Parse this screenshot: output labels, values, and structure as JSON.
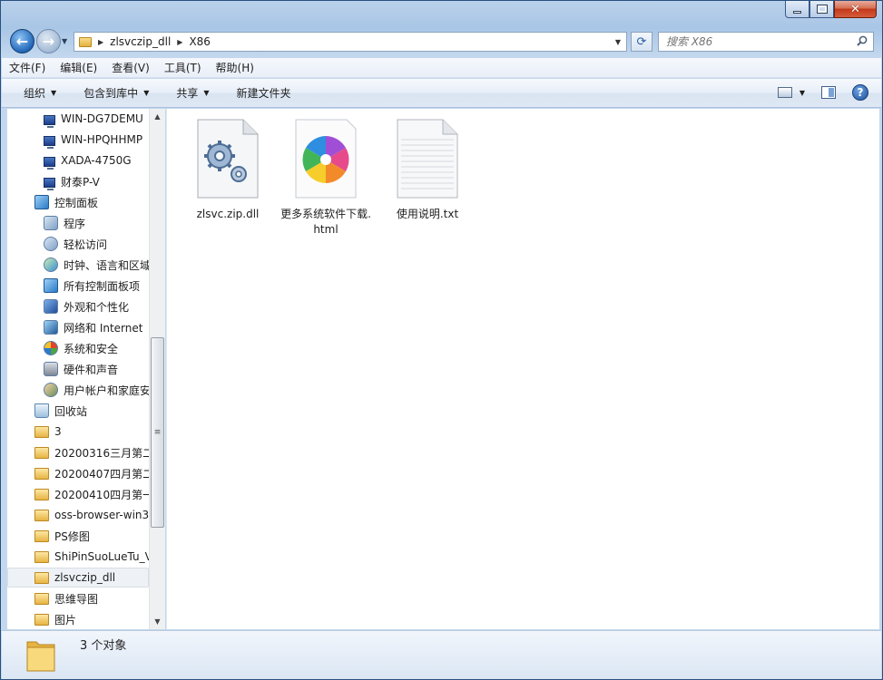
{
  "window": {
    "controls": {
      "minimize": "minimize",
      "maximize": "maximize",
      "close": "✕"
    }
  },
  "address": {
    "crumbs": [
      "zlsvczip_dll",
      "X86"
    ],
    "search_placeholder": "搜索 X86"
  },
  "menubar": {
    "items": [
      "文件(F)",
      "编辑(E)",
      "查看(V)",
      "工具(T)",
      "帮助(H)"
    ]
  },
  "toolbar": {
    "organize": "组织",
    "include_in_library": "包含到库中",
    "share": "共享",
    "new_folder": "新建文件夹"
  },
  "nav": {
    "items": [
      {
        "label": "WIN-DG7DEMU",
        "icon": "computer-icon"
      },
      {
        "label": "WIN-HPQHHMP",
        "icon": "computer-icon"
      },
      {
        "label": "XADA-4750G",
        "icon": "computer-icon"
      },
      {
        "label": "财泰P-V",
        "icon": "computer-icon"
      },
      {
        "label": "控制面板",
        "icon": "control-panel-icon"
      },
      {
        "label": "程序",
        "icon": "programs-icon"
      },
      {
        "label": "轻松访问",
        "icon": "ease-of-access-icon"
      },
      {
        "label": "时钟、语言和区域",
        "icon": "clock-language-icon"
      },
      {
        "label": "所有控制面板项",
        "icon": "control-panel-items-icon"
      },
      {
        "label": "外观和个性化",
        "icon": "appearance-icon"
      },
      {
        "label": "网络和 Internet",
        "icon": "network-icon"
      },
      {
        "label": "系统和安全",
        "icon": "system-security-icon"
      },
      {
        "label": "硬件和声音",
        "icon": "hardware-sound-icon"
      },
      {
        "label": "用户帐户和家庭安全",
        "icon": "user-accounts-icon"
      },
      {
        "label": "回收站",
        "icon": "recycle-bin-icon"
      },
      {
        "label": "3",
        "icon": "folder-icon"
      },
      {
        "label": "20200316三月第二",
        "icon": "folder-icon"
      },
      {
        "label": "20200407四月第二",
        "icon": "folder-icon"
      },
      {
        "label": "20200410四月第一",
        "icon": "folder-icon"
      },
      {
        "label": "oss-browser-win3",
        "icon": "folder-icon"
      },
      {
        "label": "PS修图",
        "icon": "folder-icon"
      },
      {
        "label": "ShiPinSuoLueTu_V",
        "icon": "folder-icon"
      },
      {
        "label": "zlsvczip_dll",
        "icon": "folder-icon"
      },
      {
        "label": "思维导图",
        "icon": "folder-icon"
      },
      {
        "label": "图片",
        "icon": "folder-icon"
      }
    ]
  },
  "files": [
    {
      "name": "zlsvc.zip.dll",
      "icon": "dll-file-icon"
    },
    {
      "name": "更多系统软件下载.html",
      "icon": "html-file-icon"
    },
    {
      "name": "使用说明.txt",
      "icon": "txt-file-icon"
    }
  ],
  "status": {
    "count_text": "3 个对象"
  }
}
